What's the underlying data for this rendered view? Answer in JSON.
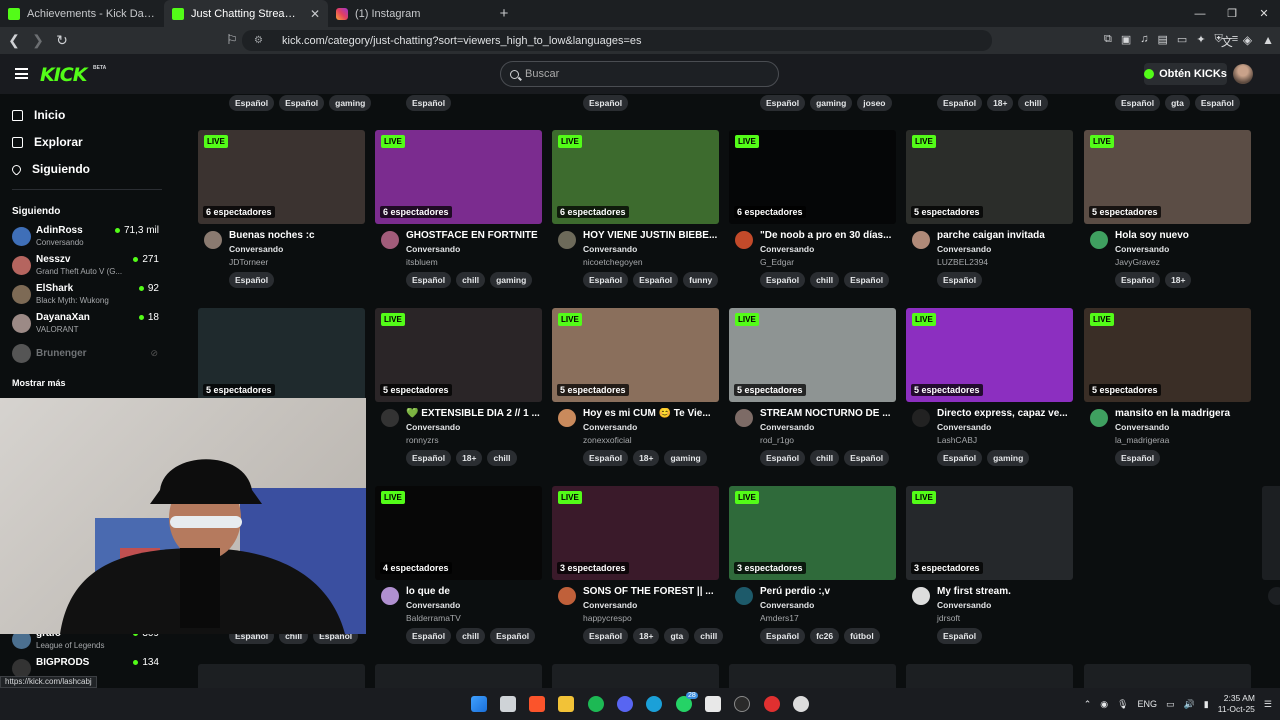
{
  "browser": {
    "tabs": [
      {
        "title": "Achievements - Kick Dashboard",
        "icon": "kick-icon"
      },
      {
        "title": "Just Chatting Streaming - Live St",
        "icon": "kick-icon"
      },
      {
        "title": "(1) Instagram",
        "icon": "instagram-icon"
      }
    ],
    "url": "kick.com/category/just-chatting?sort=viewers_high_to_low&languages=es",
    "status_url": "https://kick.com/lashcabj"
  },
  "header": {
    "logo": "KICK",
    "beta": "BETA",
    "search_placeholder": "Buscar",
    "kicks_button": "Obtén KICKs"
  },
  "sidebar": {
    "nav": [
      {
        "label": "Inicio",
        "icon": "home-icon"
      },
      {
        "label": "Explorar",
        "icon": "compass-icon"
      },
      {
        "label": "Siguiendo",
        "icon": "heart-icon"
      }
    ],
    "following_heading": "Siguiendo",
    "following": [
      {
        "name": "AdinRoss",
        "game": "Conversando",
        "viewers": "71,3 mil",
        "color": "#3f6fb8"
      },
      {
        "name": "Nesszv",
        "game": "Grand Theft Auto V (G...",
        "viewers": "271",
        "color": "#b5655f"
      },
      {
        "name": "ElShark",
        "game": "Black Myth: Wukong",
        "viewers": "92",
        "color": "#7d6a55"
      },
      {
        "name": "DayanaXan",
        "game": "VALORANT",
        "viewers": "18",
        "color": "#9c8a86"
      },
      {
        "name": "Brunenger",
        "game": "",
        "viewers": "",
        "color": "#555"
      }
    ],
    "show_more": "Mostrar más",
    "bottom_following": [
      {
        "name": "grafo",
        "game": "League of Legends",
        "viewers": "309",
        "color": "#4b6f8f"
      },
      {
        "name": "BIGPRODS",
        "game": "",
        "viewers": "134",
        "color": "#333"
      }
    ]
  },
  "top_tags": [
    [
      "Español",
      "Español",
      "gaming"
    ],
    [
      "Español"
    ],
    [
      "Español"
    ],
    [
      "Español",
      "gaming",
      "joseo"
    ],
    [
      "Español",
      "18+",
      "chill"
    ],
    [
      "Español",
      "gta",
      "Español"
    ]
  ],
  "streams": [
    {
      "live": "LIVE",
      "viewers": "6 espectadores",
      "title": "Buenas noches :c",
      "category": "Conversando",
      "user": "JDTorneer",
      "tags": [
        "Español"
      ],
      "thumb": "#3b3330",
      "avatar": "#8a7a70"
    },
    {
      "live": "LIVE",
      "viewers": "6 espectadores",
      "title": "GHOSTFACE EN FORTNITE",
      "category": "Conversando",
      "user": "itsbluem",
      "tags": [
        "Español",
        "chill",
        "gaming"
      ],
      "thumb": "#7b2c8f",
      "avatar": "#a15c7a"
    },
    {
      "live": "LIVE",
      "viewers": "6 espectadores",
      "title": "HOY VIENE JUSTIN BIEBE...",
      "category": "Conversando",
      "user": "nicoetchegoyen",
      "tags": [
        "Español",
        "Español",
        "funny"
      ],
      "thumb": "#3d6b2e",
      "avatar": "#6d6a5a"
    },
    {
      "live": "LIVE",
      "viewers": "6 espectadores",
      "title": "\"De noob a pro en 30 días...",
      "category": "Conversando",
      "user": "G_Edgar",
      "tags": [
        "Español",
        "chill",
        "Español"
      ],
      "thumb": "#050607",
      "avatar": "#c24a2a"
    },
    {
      "live": "LIVE",
      "viewers": "5 espectadores",
      "title": "parche caigan invitada",
      "category": "Conversando",
      "user": "LUZBEL2394",
      "tags": [
        "Español"
      ],
      "thumb": "#2b2d2a",
      "avatar": "#b08a78"
    },
    {
      "live": "LIVE",
      "viewers": "5 espectadores",
      "title": "Hola soy nuevo",
      "category": "Conversando",
      "user": "JavyGravez",
      "tags": [
        "Español",
        "18+"
      ],
      "thumb": "#5b4d45",
      "avatar": "#3fa060"
    },
    {
      "live": "",
      "viewers": "5 espectadores",
      "title": "",
      "category": "",
      "user": "",
      "tags": [],
      "thumb": "#1f2a2d",
      "avatar": "#444"
    },
    {
      "live": "LIVE",
      "viewers": "5 espectadores",
      "title": "💚 EXTENSIBLE DIA 2 // 1 ...",
      "category": "Conversando",
      "user": "ronnyzrs",
      "tags": [
        "Español",
        "18+",
        "chill"
      ],
      "thumb": "#2a2527",
      "avatar": "#333"
    },
    {
      "live": "LIVE",
      "viewers": "5 espectadores",
      "title": "Hoy es mi CUM 😊 Te Vie...",
      "category": "Conversando",
      "user": "zonexxoficial",
      "tags": [
        "Español",
        "18+",
        "gaming"
      ],
      "thumb": "#8a6f5c",
      "avatar": "#c98a5c"
    },
    {
      "live": "LIVE",
      "viewers": "5 espectadores",
      "title": "STREAM NOCTURNO DE ...",
      "category": "Conversando",
      "user": "rod_r1go",
      "tags": [
        "Español",
        "chill",
        "Español"
      ],
      "thumb": "#8e9493",
      "avatar": "#7d6b66"
    },
    {
      "live": "LIVE",
      "viewers": "5 espectadores",
      "title": "Directo express, capaz ve...",
      "category": "Conversando",
      "user": "LashCABJ",
      "tags": [
        "Español",
        "gaming"
      ],
      "thumb": "#8c2fc0",
      "avatar": "#222"
    },
    {
      "live": "LIVE",
      "viewers": "5 espectadores",
      "title": "mansito en la madrigera",
      "category": "Conversando",
      "user": "la_madrigeraa",
      "tags": [
        "Español"
      ],
      "thumb": "#3a2e26",
      "avatar": "#3fa060"
    },
    {
      "live": "",
      "viewers": "",
      "title": "",
      "category": "",
      "user": "",
      "tags": [
        "Español",
        "chill",
        "Español"
      ],
      "thumb": "",
      "avatar": ""
    },
    {
      "live": "LIVE",
      "viewers": "4 espectadores",
      "title": "lo que de",
      "category": "Conversando",
      "user": "BalderramaTV",
      "tags": [
        "Español",
        "chill",
        "Español"
      ],
      "thumb": "#070707",
      "avatar": "#b090d0"
    },
    {
      "live": "LIVE",
      "viewers": "3 espectadores",
      "title": "SONS OF THE FOREST || ...",
      "category": "Conversando",
      "user": "happycrespo",
      "tags": [
        "Español",
        "18+",
        "gta",
        "chill"
      ],
      "thumb": "#3a1a2a",
      "avatar": "#c0603a"
    },
    {
      "live": "LIVE",
      "viewers": "3 espectadores",
      "title": "Perú perdio :,v",
      "category": "Conversando",
      "user": "Amders17",
      "tags": [
        "Español",
        "fc26",
        "fútbol"
      ],
      "thumb": "#2f6a3a",
      "avatar": "#1d5a6a"
    },
    {
      "live": "LIVE",
      "viewers": "3 espectadores",
      "title": "My first stream.",
      "category": "Conversando",
      "user": "jdrsoft",
      "tags": [
        "Español"
      ],
      "thumb": "#25282b",
      "avatar": "#ddd"
    }
  ],
  "taskbar": {
    "lang": "ENG",
    "time": "2:35 AM",
    "date": "11-Oct-25",
    "badge": "28"
  }
}
